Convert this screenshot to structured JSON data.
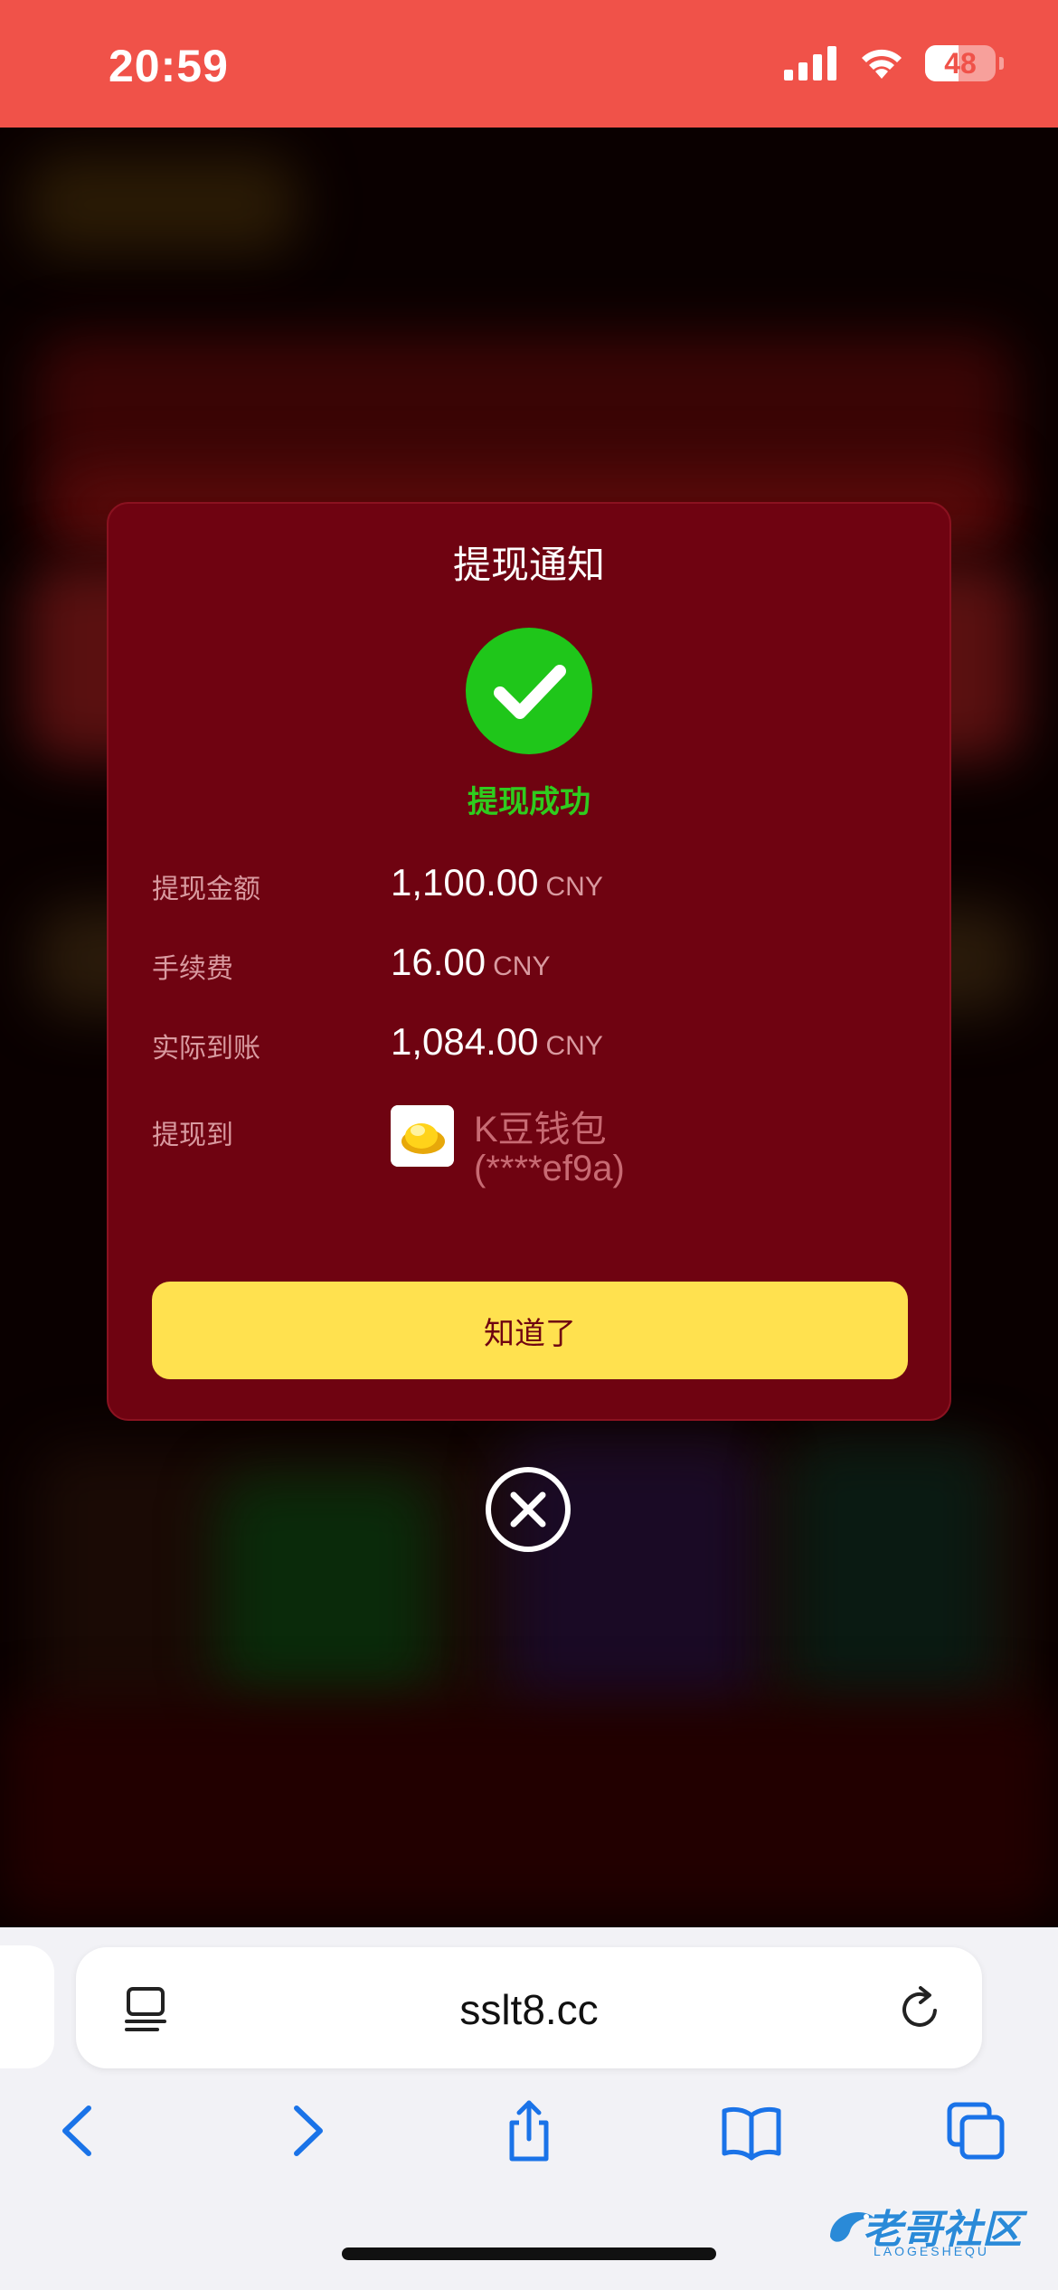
{
  "status_bar": {
    "time": "20:59",
    "battery": "48",
    "battery_level": 0.48
  },
  "modal": {
    "title": "提现通知",
    "status": "提现成功",
    "rows": [
      {
        "label": "提现金额",
        "value": "1,100.00",
        "unit": "CNY"
      },
      {
        "label": "手续费",
        "value": "16.00",
        "unit": "CNY"
      },
      {
        "label": "实际到账",
        "value": "1,084.00",
        "unit": "CNY"
      }
    ],
    "destination": {
      "label": "提现到",
      "wallet_name": "K豆钱包",
      "account": "(****ef9a)"
    },
    "confirm_label": "知道了"
  },
  "browser": {
    "url": "sslt8.cc"
  },
  "watermark": {
    "text": "老哥社区",
    "sub": "LAOGESHEQU"
  },
  "colors": {
    "status_bar": "#f05249",
    "modal_bg": "#6f0311",
    "success_green": "#2fcc1e",
    "button_yellow": "#ffe14f",
    "browser_accent": "#1a73e8"
  }
}
